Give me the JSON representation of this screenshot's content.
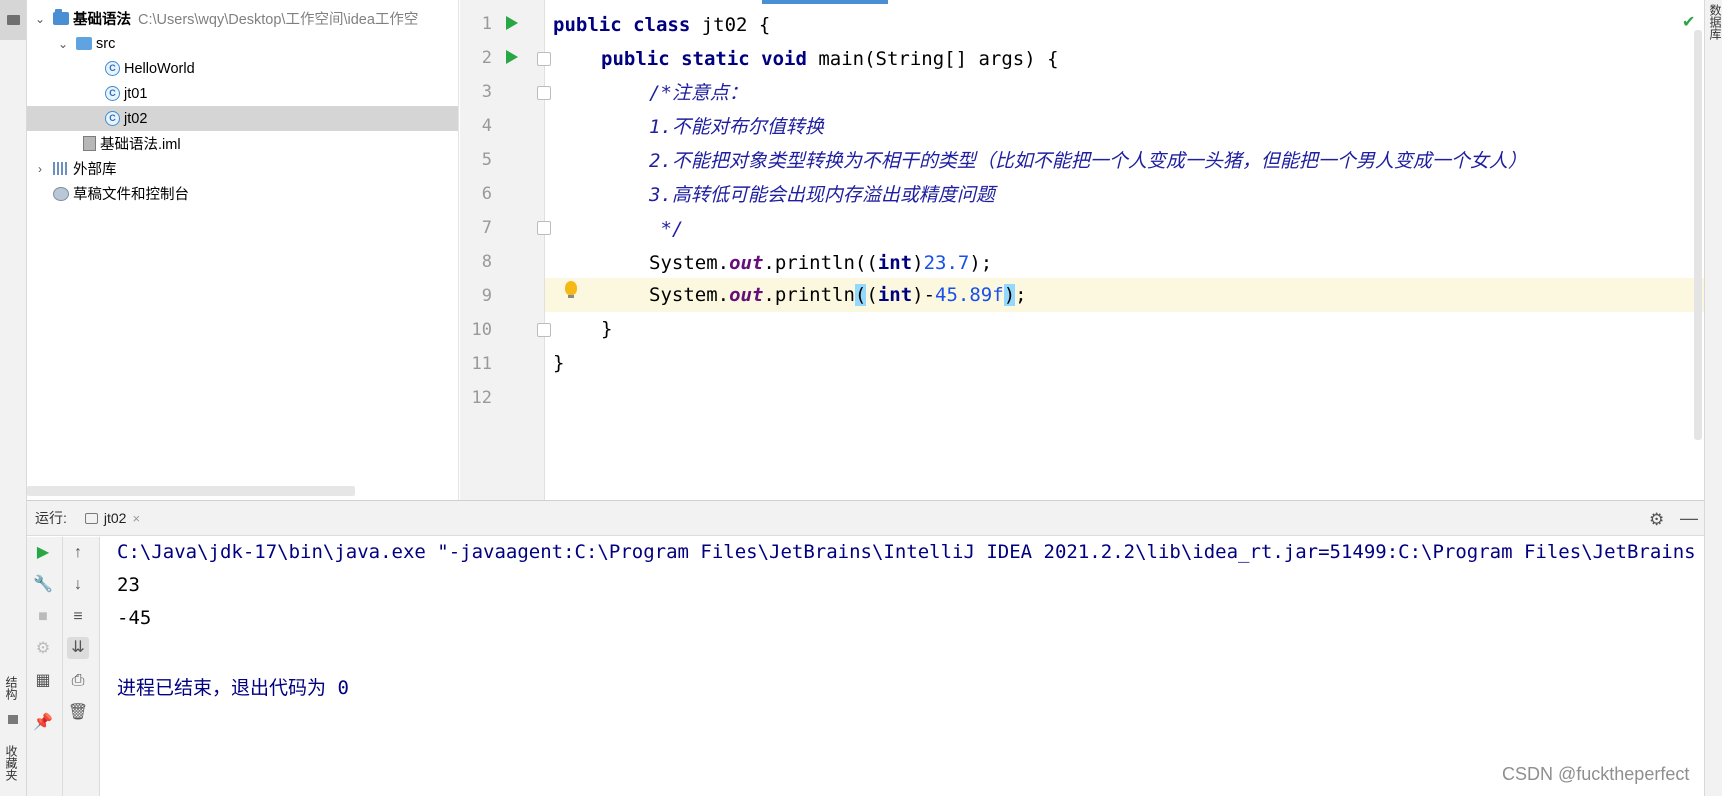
{
  "project_tree": {
    "root": {
      "name": "基础语法",
      "path": "C:\\Users\\wqy\\Desktop\\工作空间\\idea工作空"
    },
    "src": "src",
    "files": [
      "HelloWorld",
      "jt01",
      "jt02"
    ],
    "selected_file": "jt02",
    "iml": "基础语法.iml",
    "external_libs": "外部库",
    "scratches": "草稿文件和控制台"
  },
  "editor": {
    "line_numbers": [
      "1",
      "2",
      "3",
      "4",
      "5",
      "6",
      "7",
      "8",
      "9",
      "10",
      "11",
      "12"
    ],
    "lines": {
      "l1_kw": "public class",
      "l1_rest": " jt02 {",
      "l2_kw": "public static void",
      "l2_rest": " main(String[] args) {",
      "l3": "/*注意点：",
      "l4": "1.不能对布尔值转换",
      "l5": "2.不能把对象类型转换为不相干的类型（比如不能把一个人变成一头猪，但能把一个男人变成一个女人）",
      "l6": "3.高转低可能会出现内存溢出或精度问题",
      "l7": " */",
      "l8_a": "System.",
      "l8_field": "out",
      "l8_b": ".println((",
      "l8_kw": "int",
      "l8_c": ")",
      "l8_num": "23.7",
      "l8_d": ");",
      "l9_a": "System.",
      "l9_field": "out",
      "l9_b": ".println",
      "l9_paren_open": "(",
      "l9_c": "(",
      "l9_kw": "int",
      "l9_d": ")-",
      "l9_num": "45.89f",
      "l9_paren_close": ")",
      "l9_e": ";",
      "l10": "}",
      "l11": "}"
    }
  },
  "run_panel": {
    "label": "运行:",
    "tab": "jt02",
    "tab_close": "×",
    "output": {
      "command": "C:\\Java\\jdk-17\\bin\\java.exe \"-javaagent:C:\\Program Files\\JetBrains\\IntelliJ IDEA 2021.2.2\\lib\\idea_rt.jar=51499:C:\\Program Files\\JetBrains",
      "line1": "23",
      "line2": "-45",
      "exit_text": "进程已结束，退出代码为 ",
      "exit_code": "0"
    }
  },
  "side_tabs": {
    "structure": "结构",
    "favorites": "收藏夹",
    "database": "数据库"
  },
  "watermark": "CSDN @fucktheperfect",
  "colors": {
    "keyword": "#000080",
    "comment": "#1f1fa0",
    "number": "#1750eb",
    "static_field": "#660e7a",
    "current_line": "#fcf8df",
    "run_green": "#28a745"
  }
}
